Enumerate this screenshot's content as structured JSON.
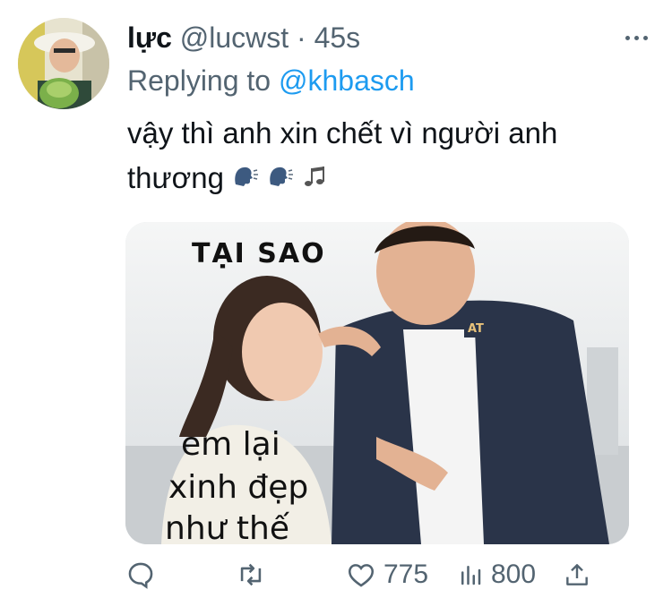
{
  "tweet": {
    "display_name": "lực",
    "handle": "@lucwst",
    "separator": "·",
    "time": "45s",
    "replying_prefix": "Replying to",
    "replying_handle": "@khbasch",
    "text_line1": "vậy thì anh xin chết vì người anh",
    "text_line2": "thương",
    "emojis": [
      "speaking-head-emoji",
      "speaking-head-emoji",
      "musical-notes-emoji"
    ]
  },
  "media": {
    "caption_top": "TẠI SAO",
    "caption_line1": "em lại",
    "caption_line2": "xinh đẹp",
    "caption_line3": "như thế",
    "badge_text": "AT"
  },
  "actions": {
    "like_count": "775",
    "views_count": "800"
  },
  "colors": {
    "accent": "#1d9bf0",
    "secondary_text": "#536471",
    "primary_text": "#0f1419"
  }
}
